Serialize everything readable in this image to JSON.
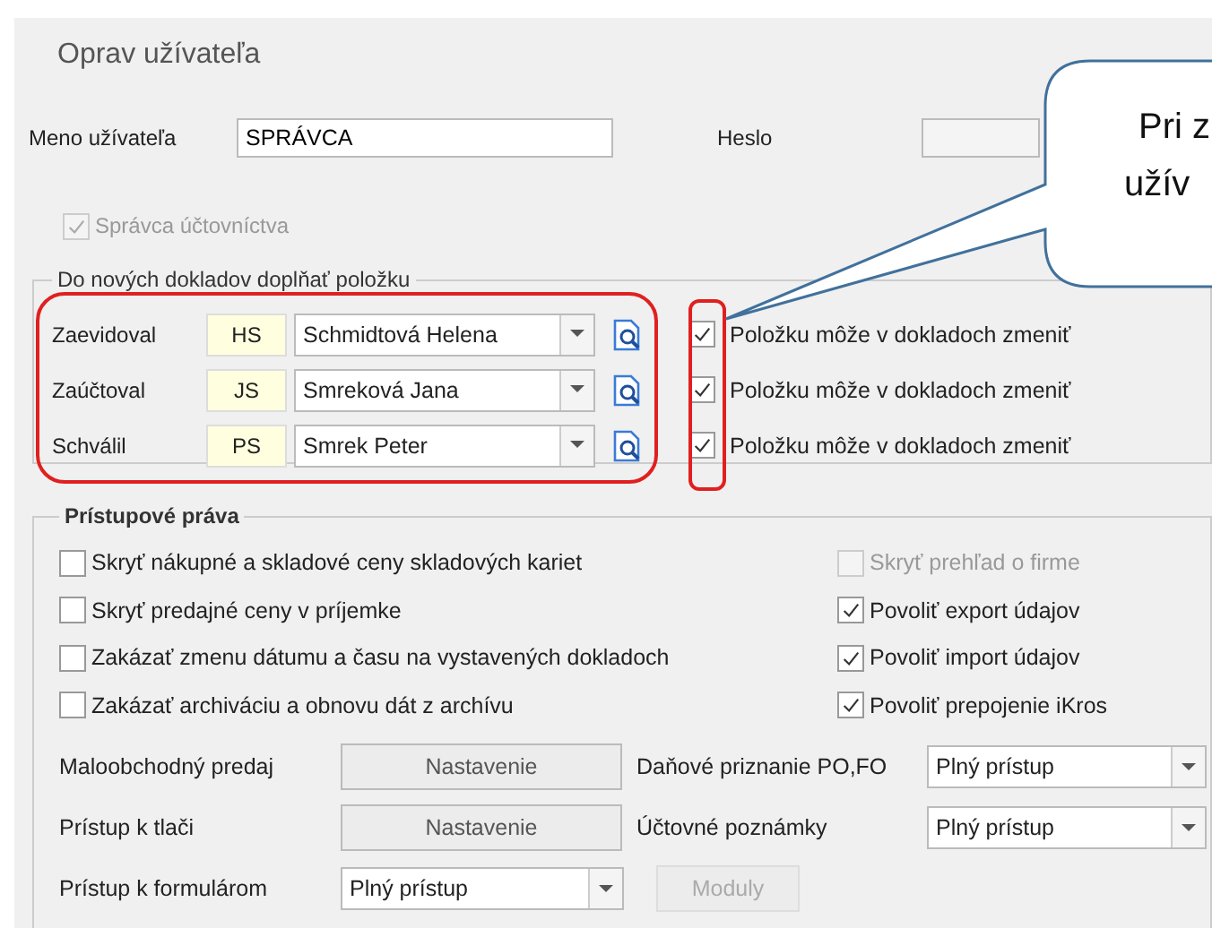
{
  "window": {
    "title": "Oprav užívateľa"
  },
  "user": {
    "name_label": "Meno užívateľa",
    "name_value": "SPRÁVCA",
    "password_label": "Heslo"
  },
  "admin": {
    "label": "Správca účtovníctva",
    "checked": true,
    "disabled": true
  },
  "defaults": {
    "title": "Do nových dokladov doplňať položku",
    "rows": [
      {
        "label": "Zaevidoval",
        "code": "HS",
        "name": "Schmidtová Helena",
        "change_label": "Položku môže v dokladoch zmeniť",
        "checked": true
      },
      {
        "label": "Zaúčtoval",
        "code": "JS",
        "name": "Smreková Jana",
        "change_label": "Položku môže v dokladoch zmeniť",
        "checked": true
      },
      {
        "label": "Schválil",
        "code": "PS",
        "name": "Smrek Peter",
        "change_label": "Položku môže v dokladoch zmeniť",
        "checked": true
      }
    ]
  },
  "permissions": {
    "title": "Prístupové práva",
    "left": [
      {
        "label": "Skryť nákupné a skladové ceny skladových kariet",
        "checked": false,
        "disabled": false
      },
      {
        "label": "Skryť predajné ceny v príjemke",
        "checked": false,
        "disabled": false
      },
      {
        "label": "Zakázať zmenu dátumu a času na vystavených dokladoch",
        "checked": false,
        "disabled": false
      },
      {
        "label": "Zakázať archiváciu a obnovu dát z archívu",
        "checked": false,
        "disabled": false
      }
    ],
    "right": [
      {
        "label": "Skryť prehľad o firme",
        "checked": false,
        "disabled": true
      },
      {
        "label": "Povoliť export údajov",
        "checked": true,
        "disabled": false
      },
      {
        "label": "Povoliť import údajov",
        "checked": true,
        "disabled": false
      },
      {
        "label": "Povoliť prepojenie iKros",
        "checked": true,
        "disabled": false
      }
    ],
    "settings": [
      {
        "label": "Maloobchodný predaj",
        "button": "Nastavenie",
        "right_label": "Daňové priznanie PO,FO",
        "right_value": "Plný prístup"
      },
      {
        "label": "Prístup k tlači",
        "button": "Nastavenie",
        "right_label": "Účtovné poznámky",
        "right_value": "Plný prístup"
      }
    ],
    "forms": {
      "label": "Prístup k formulárom",
      "value": "Plný prístup",
      "button": "Moduly",
      "button_disabled": true
    }
  },
  "callout": {
    "lines": [
      "Pri z",
      "užív"
    ]
  }
}
